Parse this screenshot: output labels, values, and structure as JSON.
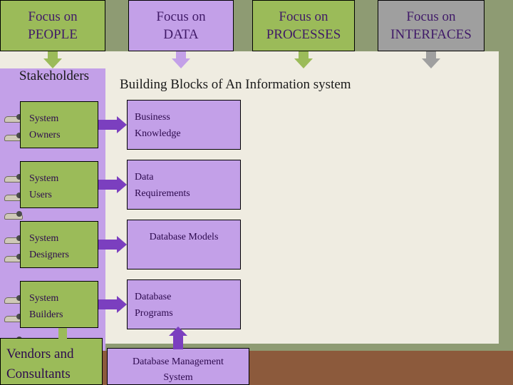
{
  "banner": {
    "boxes": [
      {
        "line1": "Focus on",
        "line2": "PEOPLE",
        "color": "#9bbb59"
      },
      {
        "line1": "Focus on",
        "line2": "DATA",
        "color": "#c3a0e8"
      },
      {
        "line1": "Focus on",
        "line2": "PROCESSES",
        "color": "#9bbb59"
      },
      {
        "line1": "Focus on",
        "line2": "INTERFACES",
        "color": "#9f9f9f"
      }
    ]
  },
  "headings": {
    "stakeholders": "Stakeholders",
    "title": "Building Blocks of An Information system"
  },
  "stakeholders": [
    {
      "line1": "System",
      "line2": "Owners"
    },
    {
      "line1": "System",
      "line2": "Users"
    },
    {
      "line1": "System",
      "line2": "Designers"
    },
    {
      "line1": "System",
      "line2": "Builders"
    },
    {
      "line1": "Vendors and",
      "line2": "Consultants"
    }
  ],
  "data_blocks": [
    {
      "line1": "Business",
      "line2": "Knowledge"
    },
    {
      "line1": "Data",
      "line2": "Requirements"
    },
    {
      "line1": "Database Models",
      "line2": ""
    },
    {
      "line1": "Database",
      "line2": "Programs"
    },
    {
      "line1": "Database Management",
      "line2": "System"
    }
  ],
  "colors": {
    "green": "#9bbb59",
    "purple": "#c3a0e8",
    "gray": "#9f9f9f",
    "arrow_purple": "#7b3fbf",
    "cream": "#efece1",
    "olive": "#8e9b73",
    "brown": "#8c5a3c"
  }
}
